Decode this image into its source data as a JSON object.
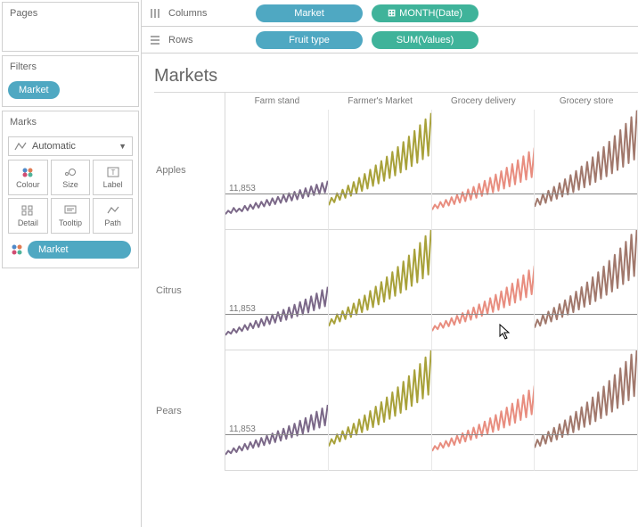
{
  "sidebar": {
    "pages_label": "Pages",
    "filters_label": "Filters",
    "filter_pill": "Market",
    "marks_label": "Marks",
    "marks_type": "Automatic",
    "buttons": {
      "colour": "Colour",
      "size": "Size",
      "label": "Label",
      "detail": "Detail",
      "tooltip": "Tooltip",
      "path": "Path"
    },
    "colour_assignment": "Market"
  },
  "shelves": {
    "columns_label": "Columns",
    "rows_label": "Rows",
    "columns": [
      "Market",
      "MONTH(Date)"
    ],
    "rows": [
      "Fruit type",
      "SUM(Values)"
    ]
  },
  "viz": {
    "title": "Markets",
    "column_headers": [
      "Farm stand",
      "Farmer's Market",
      "Grocery delivery",
      "Grocery store"
    ],
    "row_headers": [
      "Apples",
      "Citrus",
      "Pears"
    ],
    "reference_value": "11,853"
  },
  "chart_data": {
    "type": "line",
    "layout": "trellis",
    "facet_columns": [
      "Farm stand",
      "Farmer's Market",
      "Grocery delivery",
      "Grocery store"
    ],
    "facet_rows": [
      "Apples",
      "Citrus",
      "Pears"
    ],
    "x_field": "MONTH(Date)",
    "y_field": "SUM(Values)",
    "reference_line": 11853,
    "ylim_approx": [
      0,
      40000
    ],
    "colors": {
      "Farm stand": "#7b6888",
      "Farmer's Market": "#a8a13a",
      "Grocery delivery": "#e88d7f",
      "Grocery store": "#a1786c"
    },
    "series": [
      {
        "row": "Apples",
        "col": "Farm stand",
        "values": [
          5000,
          6200,
          5400,
          7100,
          5800,
          6900,
          6000,
          7800,
          6300,
          8200,
          6800,
          8800,
          7200,
          9200,
          7600,
          9800,
          8000,
          10300,
          8400,
          10800,
          8800,
          11400,
          9200,
          12000,
          9600,
          12500,
          10000,
          13100,
          10400,
          13700,
          10900,
          14300,
          11400,
          14900,
          11800,
          15500,
          12300,
          16200
        ]
      },
      {
        "row": "Apples",
        "col": "Farmer's Market",
        "values": [
          8000,
          10500,
          9000,
          12000,
          9800,
          13200,
          10500,
          14600,
          11200,
          15800,
          12000,
          17200,
          12800,
          18500,
          13600,
          19900,
          14500,
          21400,
          15300,
          22800,
          16200,
          24300,
          17100,
          25900,
          18000,
          27500,
          19000,
          29200,
          20000,
          31000,
          21100,
          32900,
          22200,
          34800,
          23400,
          36800,
          24600,
          38900
        ]
      },
      {
        "row": "Apples",
        "col": "Grocery delivery",
        "values": [
          6500,
          8200,
          7000,
          9100,
          7400,
          9800,
          7900,
          10700,
          8400,
          11500,
          8900,
          12400,
          9400,
          13300,
          9900,
          14200,
          10500,
          15200,
          11100,
          16200,
          11700,
          17200,
          12300,
          18300,
          12900,
          19400,
          13600,
          20600,
          14300,
          21800,
          15000,
          23100,
          15800,
          24400,
          16600,
          25800,
          17400,
          27300
        ]
      },
      {
        "row": "Apples",
        "col": "Grocery store",
        "values": [
          7500,
          10200,
          8200,
          11800,
          8800,
          12900,
          9500,
          14200,
          10200,
          15400,
          10900,
          16700,
          11600,
          18100,
          12400,
          19500,
          13200,
          21000,
          14000,
          22500,
          14900,
          24100,
          15800,
          25800,
          16700,
          27500,
          17700,
          29300,
          18700,
          31200,
          19800,
          33200,
          20900,
          35300,
          22100,
          37500,
          23300,
          39800
        ]
      },
      {
        "row": "Citrus",
        "col": "Farm stand",
        "values": [
          4800,
          6000,
          5300,
          6900,
          5700,
          7400,
          6200,
          8200,
          6600,
          8800,
          7100,
          9600,
          7500,
          10200,
          8000,
          11000,
          8500,
          11700,
          9000,
          12500,
          9500,
          13300,
          10000,
          14100,
          10600,
          15000,
          11200,
          15900,
          11800,
          16800,
          12400,
          17800,
          13100,
          18800,
          13800,
          19900,
          14500,
          21000
        ]
      },
      {
        "row": "Citrus",
        "col": "Farmer's Market",
        "values": [
          7800,
          10200,
          8700,
          11800,
          9400,
          12900,
          10200,
          14200,
          10900,
          15400,
          11700,
          16800,
          12500,
          18100,
          13300,
          19600,
          14200,
          21100,
          15100,
          22600,
          16000,
          24200,
          17000,
          25900,
          18000,
          27700,
          19000,
          29500,
          20100,
          31500,
          21300,
          33500,
          22500,
          35700,
          23800,
          38000,
          25100,
          40400
        ]
      },
      {
        "row": "Citrus",
        "col": "Grocery delivery",
        "values": [
          6200,
          7900,
          6800,
          8900,
          7300,
          9600,
          7800,
          10500,
          8300,
          11300,
          8900,
          12200,
          9400,
          13100,
          10000,
          14100,
          10600,
          15100,
          11300,
          16100,
          11900,
          17200,
          12600,
          18300,
          13300,
          19500,
          14100,
          20800,
          14900,
          22100,
          15700,
          23500,
          16600,
          24900,
          17500,
          26500,
          18500,
          28100
        ]
      },
      {
        "row": "Citrus",
        "col": "Grocery store",
        "values": [
          7300,
          10000,
          8000,
          11600,
          8700,
          12700,
          9400,
          14000,
          10100,
          15200,
          10900,
          16500,
          11700,
          17900,
          12500,
          19400,
          13400,
          20900,
          14300,
          22500,
          15200,
          24200,
          16200,
          25900,
          17200,
          27800,
          18300,
          29700,
          19400,
          31700,
          20600,
          33900,
          21900,
          36100,
          23200,
          38500,
          24600,
          41000
        ]
      },
      {
        "row": "Pears",
        "col": "Farm stand",
        "values": [
          5100,
          6400,
          5600,
          7300,
          6000,
          7900,
          6500,
          8700,
          6900,
          9300,
          7400,
          10000,
          7800,
          10700,
          8300,
          11400,
          8800,
          12200,
          9300,
          13000,
          9800,
          13800,
          10400,
          14700,
          10900,
          15500,
          11500,
          16500,
          12100,
          17400,
          12800,
          18400,
          13500,
          19500,
          14200,
          20600,
          14900,
          21800
        ]
      },
      {
        "row": "Pears",
        "col": "Farmer's Market",
        "values": [
          7900,
          10300,
          8800,
          11900,
          9500,
          13000,
          10300,
          14300,
          11000,
          15500,
          11800,
          16900,
          12600,
          18300,
          13400,
          19700,
          14300,
          21200,
          15200,
          22700,
          16100,
          24300,
          17100,
          26000,
          18100,
          27700,
          19100,
          29500,
          20200,
          31400,
          21400,
          33400,
          22600,
          35500,
          23900,
          37700,
          25200,
          40000
        ]
      },
      {
        "row": "Pears",
        "col": "Grocery delivery",
        "values": [
          6300,
          8000,
          6900,
          9000,
          7400,
          9700,
          7900,
          10600,
          8400,
          11400,
          9000,
          12300,
          9500,
          13200,
          10100,
          14200,
          10700,
          15200,
          11400,
          16200,
          12000,
          17300,
          12700,
          18400,
          13400,
          19600,
          14200,
          20900,
          15000,
          22200,
          15800,
          23600,
          16700,
          25000,
          17600,
          26600,
          18600,
          28200
        ]
      },
      {
        "row": "Pears",
        "col": "Grocery store",
        "values": [
          7400,
          10100,
          8100,
          11700,
          8800,
          12800,
          9500,
          14100,
          10200,
          15300,
          11000,
          16600,
          11800,
          18000,
          12600,
          19500,
          13500,
          21000,
          14400,
          22600,
          15300,
          24300,
          16300,
          26000,
          17300,
          27900,
          18400,
          29800,
          19500,
          31800,
          20700,
          34000,
          22000,
          36200,
          23300,
          38600,
          24700,
          41100
        ]
      }
    ]
  }
}
